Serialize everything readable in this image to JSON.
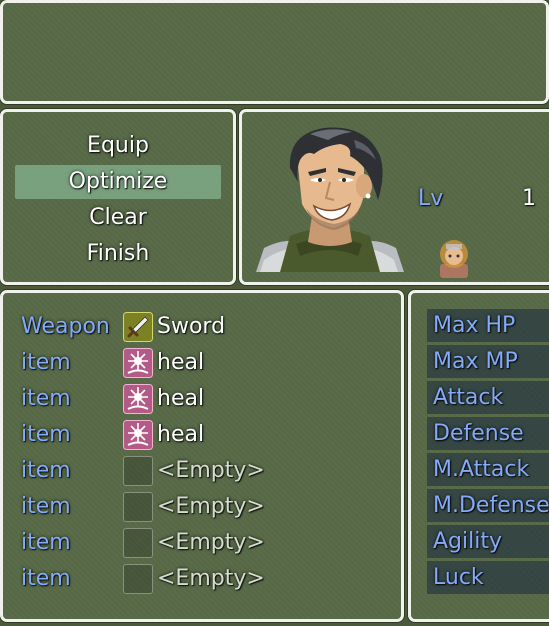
{
  "help_text": "",
  "commands": [
    {
      "label": "Equip",
      "selected": false
    },
    {
      "label": "Optimize",
      "selected": true
    },
    {
      "label": "Clear",
      "selected": false
    },
    {
      "label": "Finish",
      "selected": false
    }
  ],
  "actor": {
    "level_label": "Lv",
    "level": "1"
  },
  "slots": [
    {
      "name": "Weapon",
      "item": "Sword",
      "icon": "sword-icon"
    },
    {
      "name": "item",
      "item": "heal",
      "icon": "heal-icon"
    },
    {
      "name": "item",
      "item": "heal",
      "icon": "heal-icon"
    },
    {
      "name": "item",
      "item": "heal",
      "icon": "heal-icon"
    },
    {
      "name": "item",
      "item": "<Empty>",
      "icon": "empty-slot-icon"
    },
    {
      "name": "item",
      "item": "<Empty>",
      "icon": "empty-slot-icon"
    },
    {
      "name": "item",
      "item": "<Empty>",
      "icon": "empty-slot-icon"
    },
    {
      "name": "item",
      "item": "<Empty>",
      "icon": "empty-slot-icon"
    }
  ],
  "params": [
    "Max HP",
    "Max MP",
    "Attack",
    "Defense",
    "M.Attack",
    "M.Defense",
    "Agility",
    "Luck"
  ],
  "colors": {
    "window_bg": "#566846",
    "window_border": "#f2f2ec",
    "system_text": "#84aaf8",
    "selection": "#96cdaa"
  }
}
